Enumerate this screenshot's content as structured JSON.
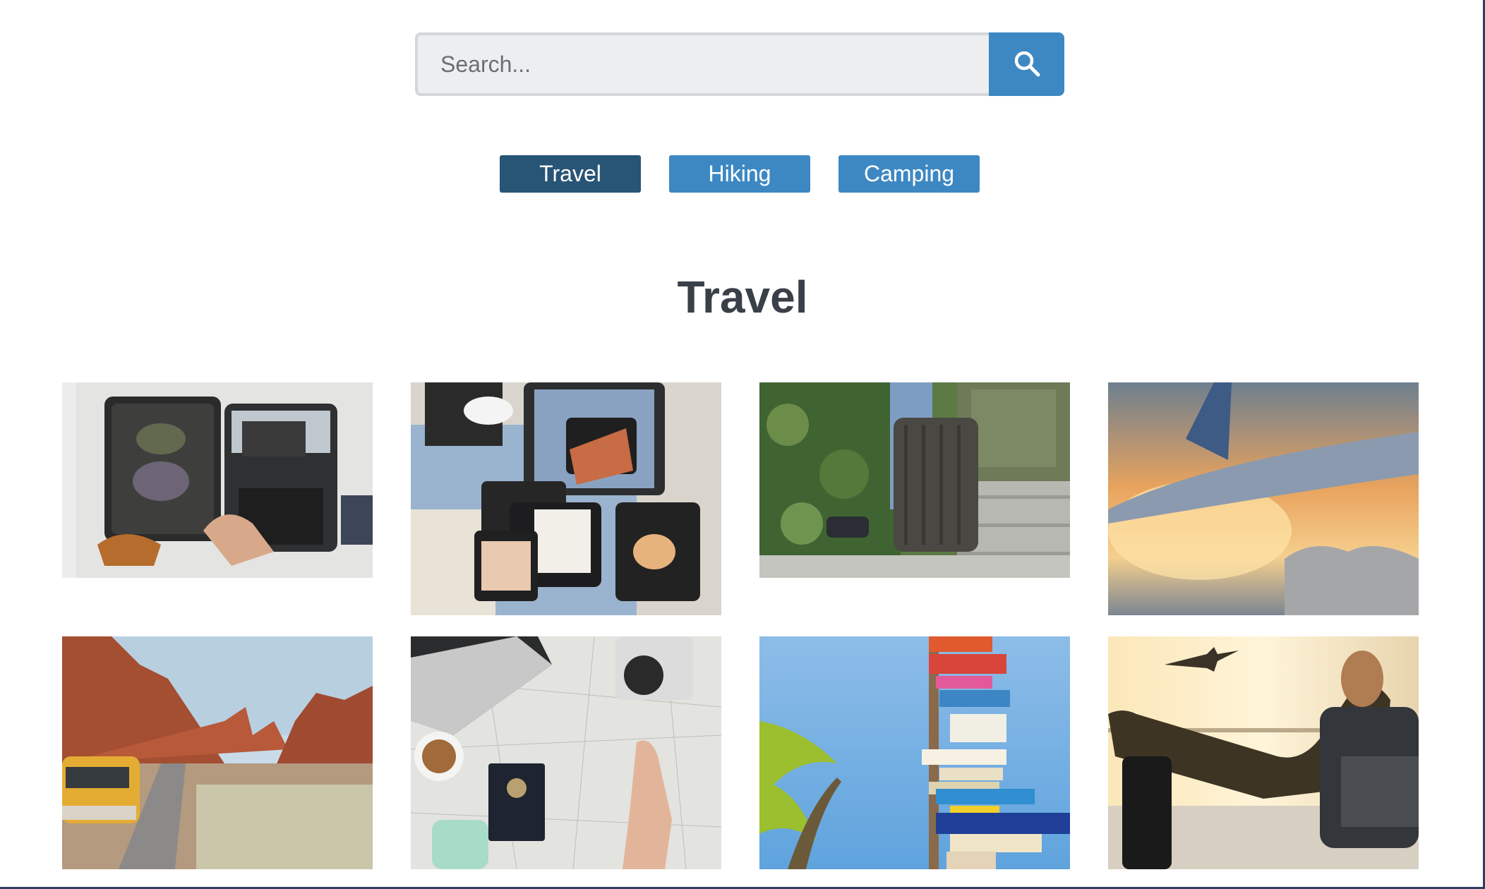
{
  "search": {
    "placeholder": "Search...",
    "button_icon": "search-icon"
  },
  "tabs": [
    {
      "label": "Travel",
      "active": true
    },
    {
      "label": "Hiking",
      "active": false
    },
    {
      "label": "Camping",
      "active": false
    }
  ],
  "section": {
    "title": "Travel"
  },
  "colors": {
    "accent": "#3d88c3",
    "accent_active": "#285476",
    "title": "#3a4048"
  },
  "photos": [
    {
      "name": "photo-open-suitcase-packing"
    },
    {
      "name": "photo-packing-cubes-on-rug"
    },
    {
      "name": "photo-suitcase-on-steps"
    },
    {
      "name": "photo-airplane-wing-sunset"
    },
    {
      "name": "photo-yellow-van-desert-road"
    },
    {
      "name": "photo-map-laptop-passport"
    },
    {
      "name": "photo-destination-signpost"
    },
    {
      "name": "photo-traveler-airport-lounge"
    }
  ]
}
